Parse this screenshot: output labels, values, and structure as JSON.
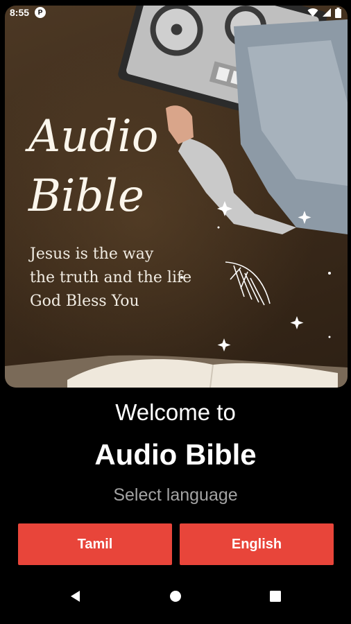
{
  "status_bar": {
    "time": "8:55",
    "app_icon_letter": "P",
    "icons": [
      "wifi-icon",
      "signal-icon",
      "battery-icon"
    ]
  },
  "banner": {
    "title": "Audio Bible",
    "verse_lines": [
      "Jesus is the way",
      "the truth and the life",
      "God Bless You"
    ]
  },
  "welcome": {
    "line1": "Welcome to",
    "app_name": "Audio Bible",
    "prompt": "Select language"
  },
  "language_buttons": [
    {
      "label": "Tamil"
    },
    {
      "label": "English"
    }
  ],
  "nav_bar": {
    "buttons": [
      "back-icon",
      "home-icon",
      "recents-icon"
    ]
  },
  "colors": {
    "accent": "#e8453a",
    "background": "#000000",
    "banner_brown": "#3b2a1a",
    "muted_text": "#a3a3a3"
  }
}
